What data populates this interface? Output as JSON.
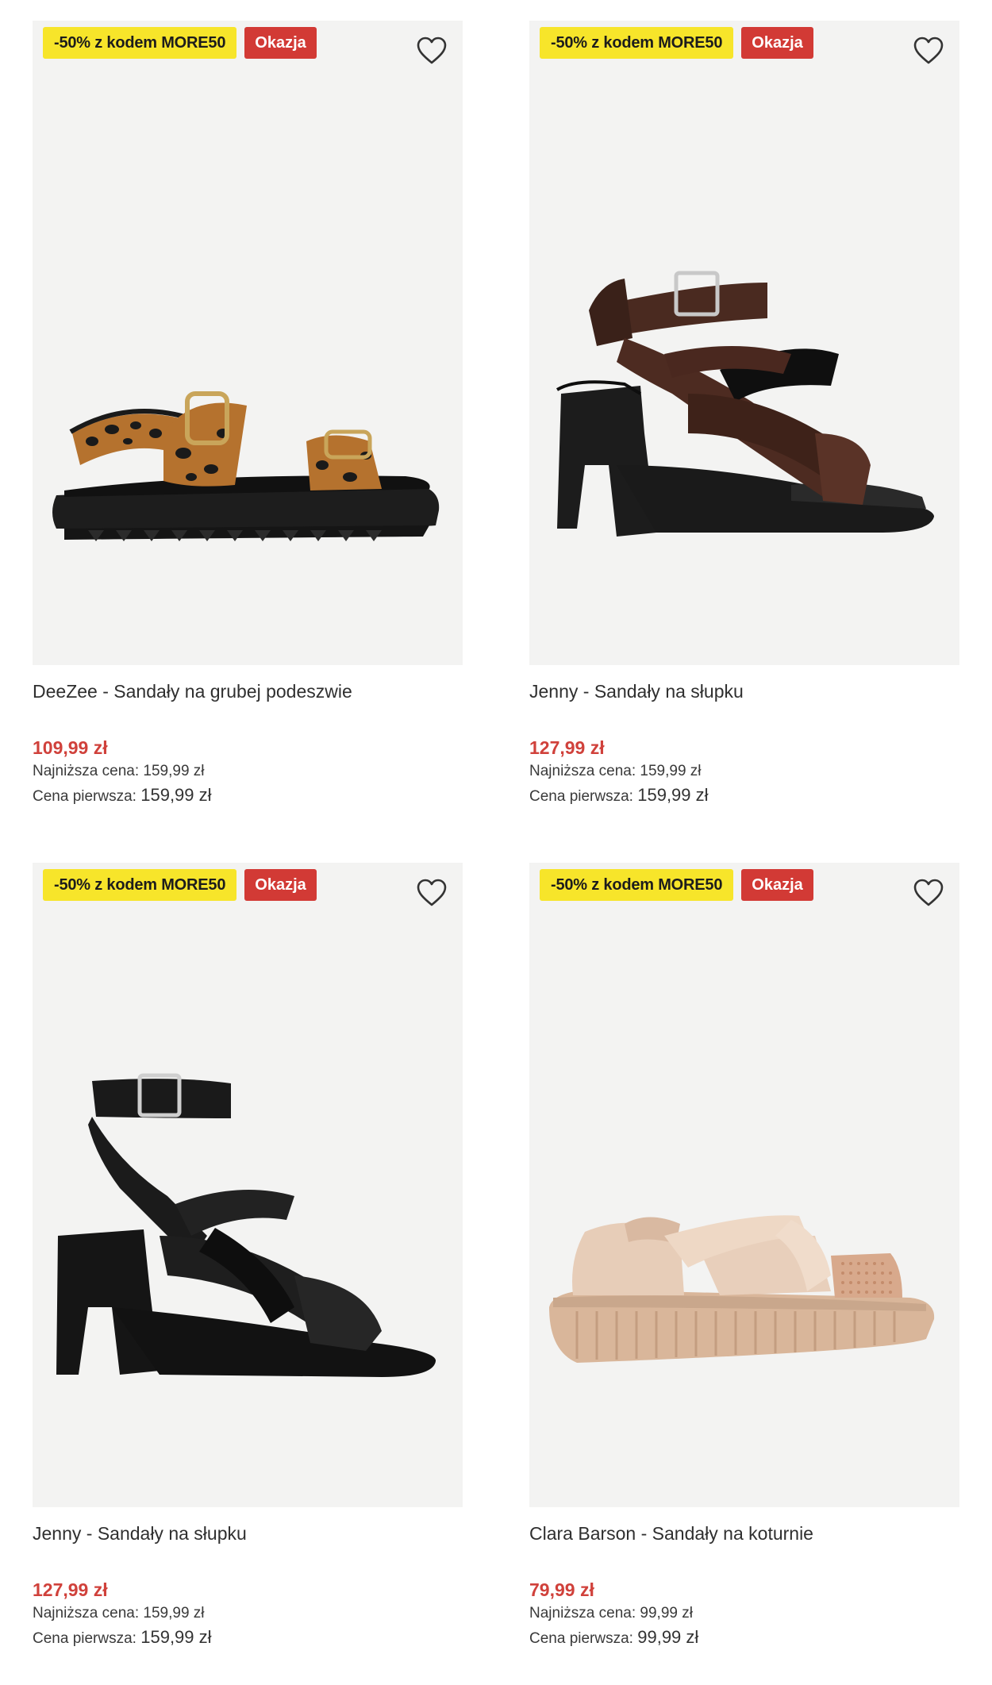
{
  "products": [
    {
      "promo_badge": "-50% z kodem MORE50",
      "deal_badge": "Okazja",
      "title": "DeeZee - Sandały na grubej podeszwie",
      "price": "109,99 zł",
      "lowest_label": "Najniższa cena:",
      "lowest_value": "159,99 zł",
      "original_label": "Cena pierwsza:",
      "original_value": "159,99 zł"
    },
    {
      "promo_badge": "-50% z kodem MORE50",
      "deal_badge": "Okazja",
      "title": "Jenny - Sandały na słupku",
      "price": "127,99 zł",
      "lowest_label": "Najniższa cena:",
      "lowest_value": "159,99 zł",
      "original_label": "Cena pierwsza:",
      "original_value": "159,99 zł"
    },
    {
      "promo_badge": "-50% z kodem MORE50",
      "deal_badge": "Okazja",
      "title": "Jenny - Sandały na słupku",
      "price": "127,99 zł",
      "lowest_label": "Najniższa cena:",
      "lowest_value": "159,99 zł",
      "original_label": "Cena pierwsza:",
      "original_value": "159,99 zł"
    },
    {
      "promo_badge": "-50% z kodem MORE50",
      "deal_badge": "Okazja",
      "title": "Clara Barson - Sandały na koturnie",
      "price": "79,99 zł",
      "lowest_label": "Najniższa cena:",
      "lowest_value": "99,99 zł",
      "original_label": "Cena pierwsza:",
      "original_value": "99,99 zł"
    }
  ],
  "colors": {
    "promo_badge": "#f7e52a",
    "deal_badge": "#d23a35",
    "price": "#d0413b",
    "image_bg": "#f3f3f2"
  },
  "icons": {
    "favorite": "heart-outline-icon"
  }
}
